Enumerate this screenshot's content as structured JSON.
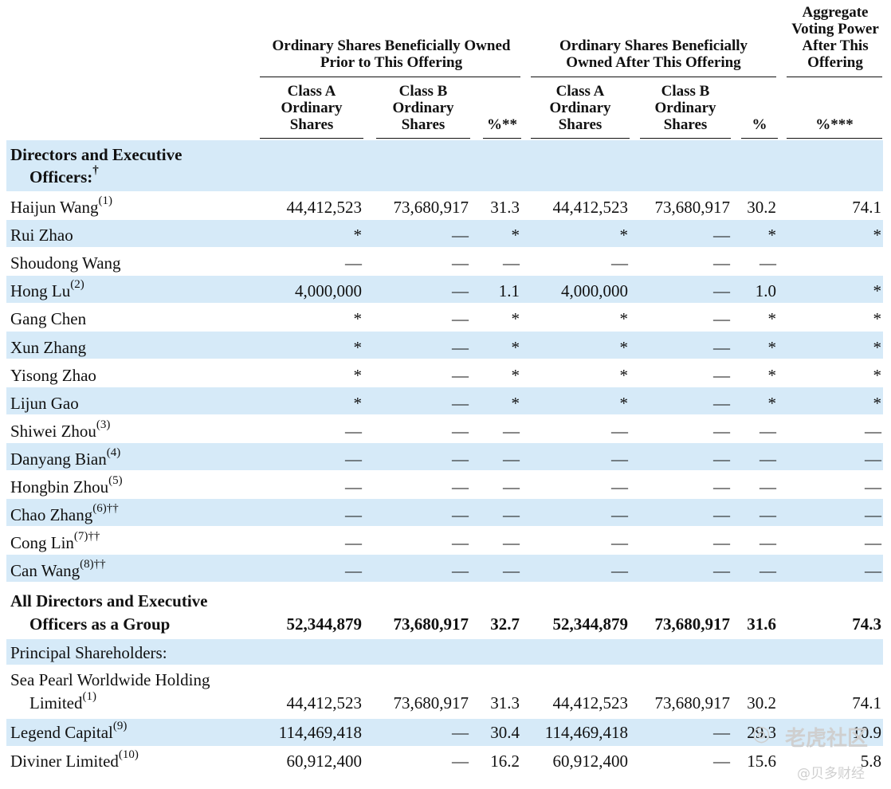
{
  "headers": {
    "prior_group": "Ordinary Shares Beneficially Owned Prior to This Offering",
    "after_group": "Ordinary Shares Beneficially Owned After This Offering",
    "aggregate_group": "Aggregate Voting Power After This Offering",
    "class_a": "Class A Ordinary Shares",
    "class_b": "Class B Ordinary Shares",
    "pct_prior": "%**",
    "pct_after": "%",
    "pct_aggregate": "%***"
  },
  "sections": {
    "directors_line1": "Directors and Executive",
    "directors_line2": "Officers:",
    "directors_mark": "†",
    "principal": "Principal Shareholders:"
  },
  "rows": [
    {
      "name": "Haijun Wang",
      "note": "(1)",
      "a1": "44,412,523",
      "b1": "73,680,917",
      "p1": "31.3",
      "a2": "44,412,523",
      "b2": "73,680,917",
      "p2": "30.2",
      "vp": "74.1"
    },
    {
      "name": "Rui Zhao",
      "note": "",
      "a1": "*",
      "b1": "—",
      "p1": "*",
      "a2": "*",
      "b2": "—",
      "p2": "*",
      "vp": "*"
    },
    {
      "name": "Shoudong Wang",
      "note": "",
      "a1": "—",
      "b1": "—",
      "p1": "—",
      "a2": "—",
      "b2": "—",
      "p2": "—",
      "vp": ""
    },
    {
      "name": "Hong Lu",
      "note": "(2)",
      "a1": "4,000,000",
      "b1": "—",
      "p1": "1.1",
      "a2": "4,000,000",
      "b2": "—",
      "p2": "1.0",
      "vp": "*"
    },
    {
      "name": "Gang Chen",
      "note": "",
      "a1": "*",
      "b1": "—",
      "p1": "*",
      "a2": "*",
      "b2": "—",
      "p2": "*",
      "vp": "*"
    },
    {
      "name": "Xun Zhang",
      "note": "",
      "a1": "*",
      "b1": "—",
      "p1": "*",
      "a2": "*",
      "b2": "—",
      "p2": "*",
      "vp": "*"
    },
    {
      "name": "Yisong Zhao",
      "note": "",
      "a1": "*",
      "b1": "—",
      "p1": "*",
      "a2": "*",
      "b2": "—",
      "p2": "*",
      "vp": "*"
    },
    {
      "name": "Lijun Gao",
      "note": "",
      "a1": "*",
      "b1": "—",
      "p1": "*",
      "a2": "*",
      "b2": "—",
      "p2": "*",
      "vp": "*"
    },
    {
      "name": "Shiwei Zhou",
      "note": "(3)",
      "a1": "—",
      "b1": "—",
      "p1": "—",
      "a2": "—",
      "b2": "—",
      "p2": "—",
      "vp": "—"
    },
    {
      "name": "Danyang Bian",
      "note": "(4)",
      "a1": "—",
      "b1": "—",
      "p1": "—",
      "a2": "—",
      "b2": "—",
      "p2": "—",
      "vp": "—"
    },
    {
      "name": "Hongbin Zhou",
      "note": "(5)",
      "a1": "—",
      "b1": "—",
      "p1": "—",
      "a2": "—",
      "b2": "—",
      "p2": "—",
      "vp": "—"
    },
    {
      "name": "Chao Zhang",
      "note": "(6)††",
      "a1": "—",
      "b1": "—",
      "p1": "—",
      "a2": "—",
      "b2": "—",
      "p2": "—",
      "vp": "—"
    },
    {
      "name": "Cong Lin",
      "note": "(7)††",
      "a1": "—",
      "b1": "—",
      "p1": "—",
      "a2": "—",
      "b2": "—",
      "p2": "—",
      "vp": "—"
    },
    {
      "name": "Can Wang",
      "note": "(8)††",
      "a1": "—",
      "b1": "—",
      "p1": "—",
      "a2": "—",
      "b2": "—",
      "p2": "—",
      "vp": "—"
    }
  ],
  "group_row": {
    "name_line1": "All Directors and Executive",
    "name_line2": "Officers as a Group",
    "a1": "52,344,879",
    "b1": "73,680,917",
    "p1": "32.7",
    "a2": "52,344,879",
    "b2": "73,680,917",
    "p2": "31.6",
    "vp": "74.3"
  },
  "principal_rows": [
    {
      "name": "Sea Pearl Worldwide Holding",
      "name2": "Limited",
      "note": "(1)",
      "a1": "44,412,523",
      "b1": "73,680,917",
      "p1": "31.3",
      "a2": "44,412,523",
      "b2": "73,680,917",
      "p2": "30.2",
      "vp": "74.1"
    },
    {
      "name": "Legend Capital",
      "name2": "",
      "note": "(9)",
      "a1": "114,469,418",
      "b1": "—",
      "p1": "30.4",
      "a2": "114,469,418",
      "b2": "—",
      "p2": "29.3",
      "vp": "10.9"
    },
    {
      "name": "Diviner Limited",
      "name2": "",
      "note": "(10)",
      "a1": "60,912,400",
      "b1": "—",
      "p1": "16.2",
      "a2": "60,912,400",
      "b2": "—",
      "p2": "15.6",
      "vp": "5.8"
    }
  ],
  "watermark": {
    "main": "老虎社区",
    "sub": "@贝多财经"
  },
  "colors": {
    "band": "#d6eaf8",
    "text": "#111111",
    "watermark": "#cfcfcf"
  }
}
